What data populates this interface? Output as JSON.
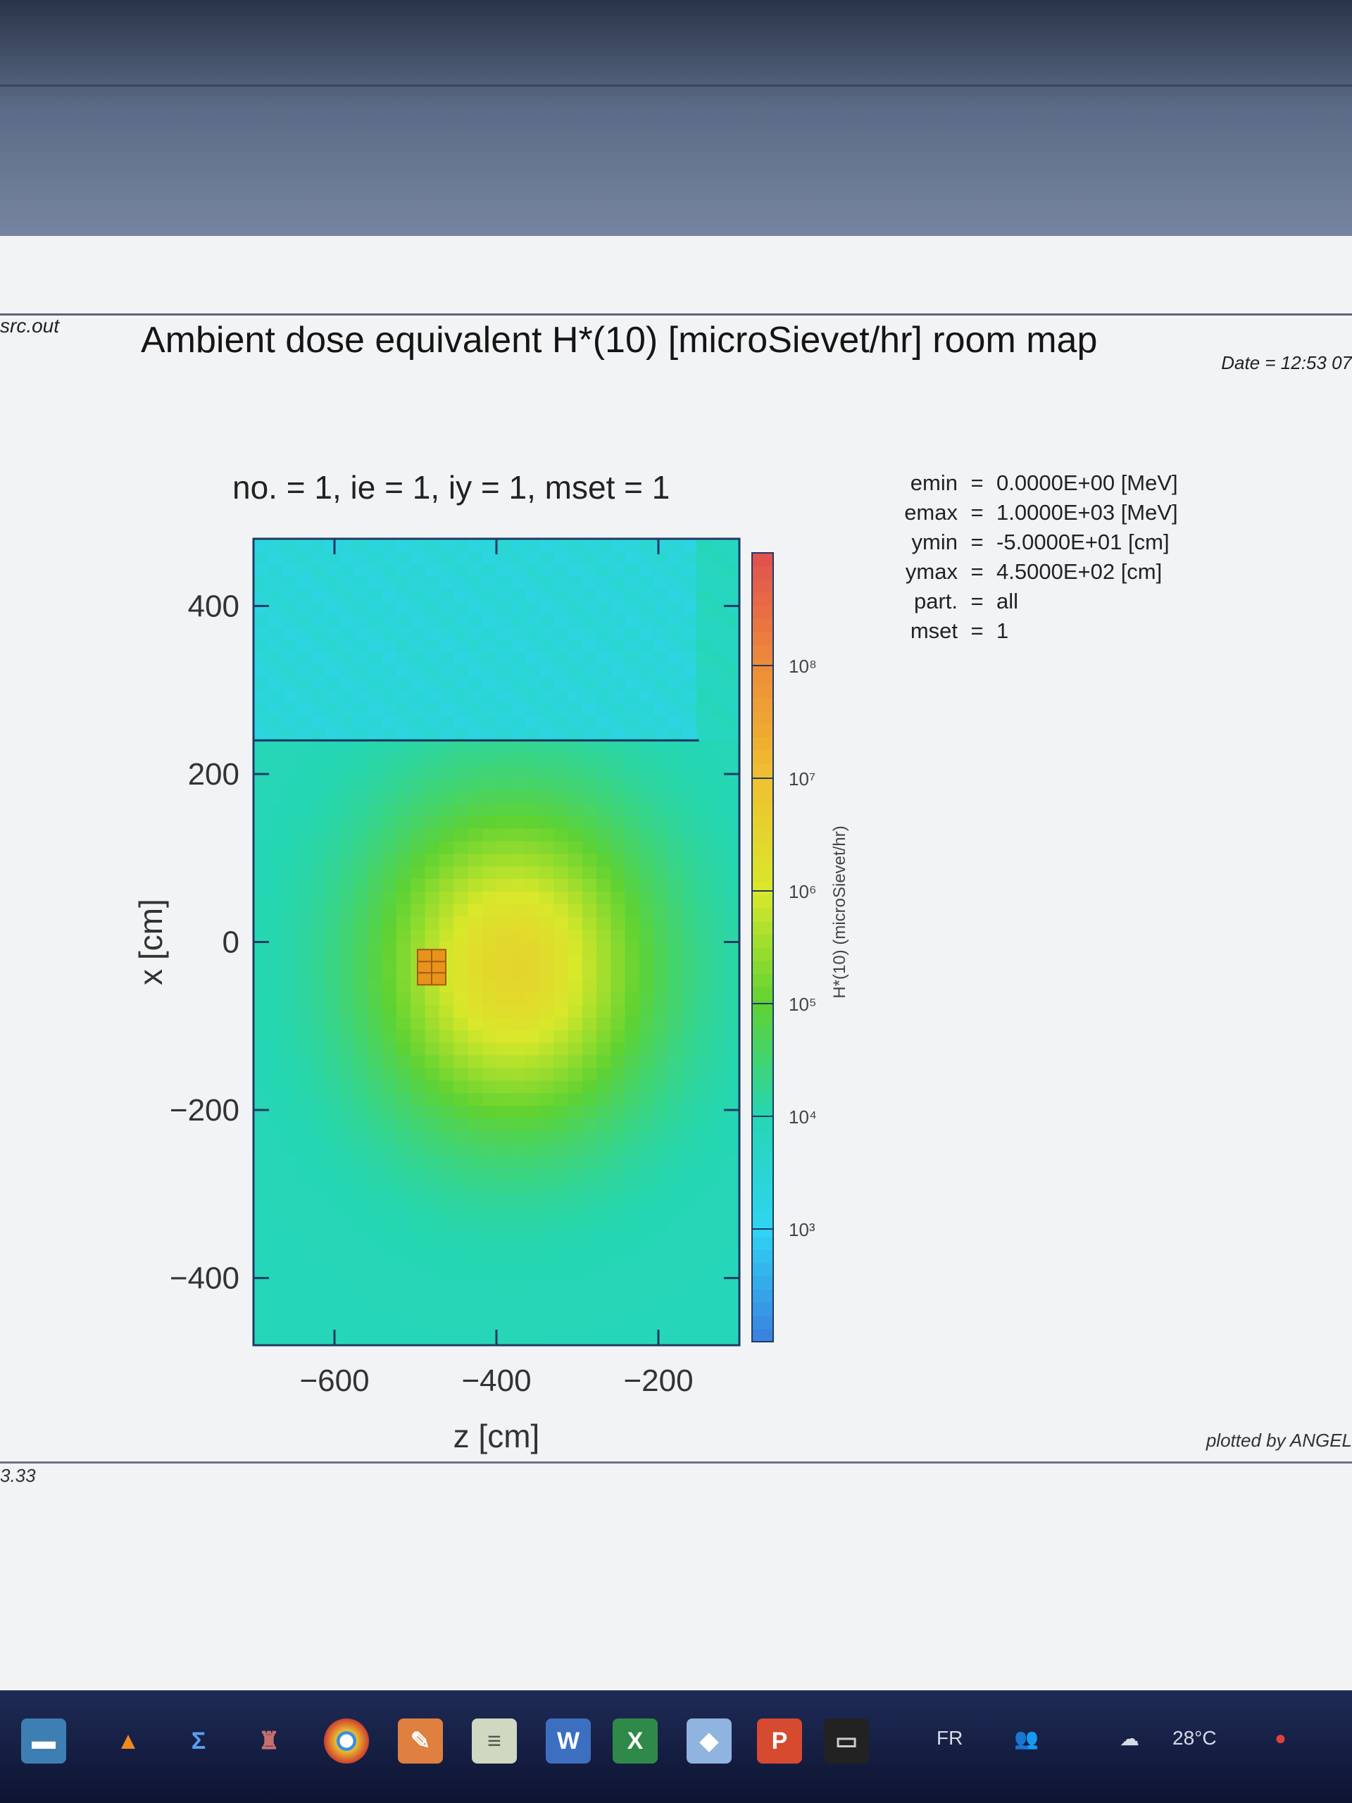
{
  "window": {
    "file_label": "src.out",
    "title": "Ambient dose equivalent H*(10) [microSievet/hr] room map",
    "date_label": "Date = 12:53 07",
    "params_line": "no. =  1,  ie =  1,  iy =  1,  mset =  1",
    "info": [
      {
        "key": "emin",
        "eq": "=",
        "value": "0.0000E+00 [MeV]"
      },
      {
        "key": "emax",
        "eq": "=",
        "value": "1.0000E+03 [MeV]"
      },
      {
        "key": "ymin",
        "eq": "=",
        "value": "-5.0000E+01 [cm]"
      },
      {
        "key": "ymax",
        "eq": "=",
        "value": "4.5000E+02 [cm]"
      },
      {
        "key": "part.",
        "eq": "=",
        "value": "all"
      },
      {
        "key": "mset",
        "eq": "=",
        "value": "1"
      }
    ],
    "footer_left": "3.33",
    "footer_right": "plotted by ANGEL"
  },
  "chart_data": {
    "type": "heatmap",
    "xlabel": "z [cm]",
    "ylabel": "x [cm]",
    "colorbar_label": "H*(10) (microSievet/hr)",
    "x_ticks": [
      -600,
      -400,
      -200
    ],
    "y_ticks": [
      400,
      200,
      0,
      -200,
      -400
    ],
    "xlim": [
      -700,
      -100
    ],
    "ylim": [
      -480,
      480
    ],
    "colorbar": {
      "scale": "log",
      "range": [
        100,
        1000000000
      ],
      "ticks": [
        {
          "value": 1000,
          "label": "10³"
        },
        {
          "value": 10000,
          "label": "10⁴"
        },
        {
          "value": 100000,
          "label": "10⁵"
        },
        {
          "value": 1000000,
          "label": "10⁶"
        },
        {
          "value": 10000000,
          "label": "10⁷"
        },
        {
          "value": 100000000,
          "label": "10⁸"
        }
      ],
      "colors": [
        "#3a7fe0",
        "#2fd5f2",
        "#25d6b2",
        "#5fd232",
        "#d9e82a",
        "#f0c030",
        "#ee8b38",
        "#e05050"
      ]
    },
    "field": {
      "background_value": 8000,
      "hotspot": {
        "z": -380,
        "x": -30,
        "value": 3000000
      },
      "region_low": {
        "z": [
          -700,
          -150
        ],
        "x": [
          240,
          480
        ],
        "value": 2500
      },
      "source_marker": {
        "z": -480,
        "x": -30
      }
    }
  },
  "taskbar": {
    "lang": "FR",
    "temperature": "28°C",
    "icons": [
      "explorer-icon",
      "vlc-icon",
      "sigma-icon",
      "app-icon",
      "chrome-icon",
      "paint-icon",
      "editor-icon",
      "word-icon",
      "excel-icon",
      "app2-icon",
      "powerpoint-icon",
      "terminal-icon"
    ]
  }
}
